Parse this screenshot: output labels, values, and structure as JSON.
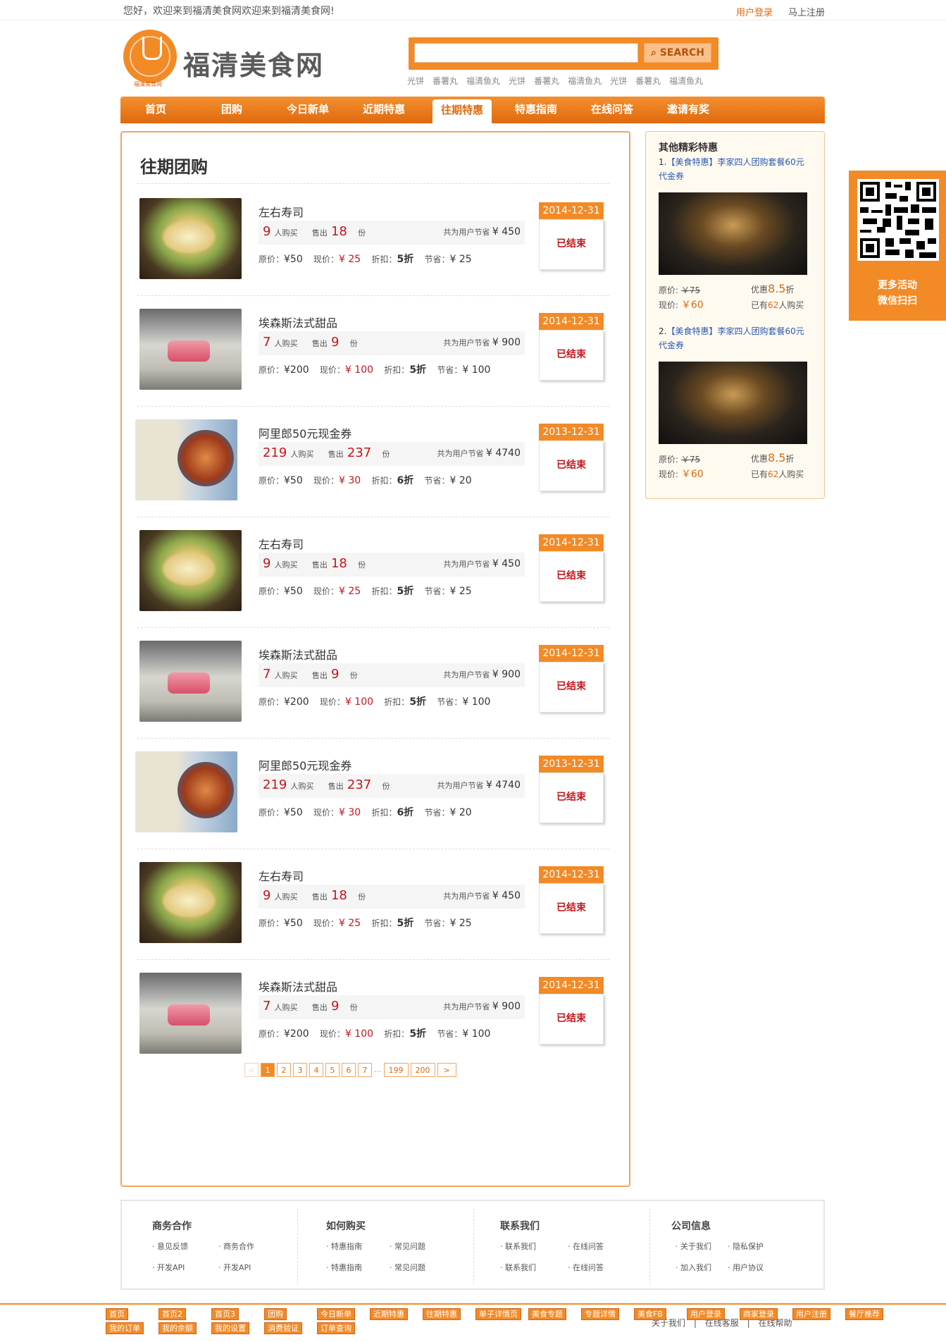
{
  "topbar": {
    "welcome": "您好，欢迎来到福清美食网欢迎来到福清美食网!",
    "login": "用户登录",
    "register": "马上注册"
  },
  "header": {
    "logo_text": "福清美食网",
    "logo_sub": "福清美食网",
    "search_placeholder": "",
    "search_button": "SEARCH",
    "hot_words": [
      "光饼",
      "番薯丸",
      "福清鱼丸",
      "光饼",
      "番薯丸",
      "福清鱼丸",
      "光饼",
      "番薯丸",
      "福清鱼丸"
    ]
  },
  "nav": {
    "items": [
      "首页",
      "团购",
      "今日新单",
      "近期特惠",
      "往期特惠",
      "特惠指南",
      "在线问答",
      "邀请有奖"
    ],
    "active_index": 4
  },
  "main": {
    "title": "往期团购",
    "deals": [
      {
        "name": "左右寿司",
        "buyers": "9",
        "buy_label": "人购买",
        "sold_label": "售出",
        "sold": "18",
        "unit": "份",
        "save_label": "共为用户节省",
        "save": "¥ 450",
        "orig_label": "原价：",
        "orig": "¥50",
        "now_label": "现价：",
        "now": "¥ 25",
        "disc_label": "折扣：",
        "disc": "5折",
        "saved_label": "节省：",
        "saved": "¥ 25",
        "date": "2014-12-31",
        "status": "已结束",
        "photo": "sushi"
      },
      {
        "name": "埃森斯法式甜品",
        "buyers": "7",
        "buy_label": "人购买",
        "sold_label": "售出",
        "sold": "9",
        "unit": "份",
        "save_label": "共为用户节省",
        "save": "¥ 900",
        "orig_label": "原价：",
        "orig": "¥200",
        "now_label": "现价：",
        "now": "¥ 100",
        "disc_label": "折扣：",
        "disc": "5折",
        "saved_label": "节省：",
        "saved": "¥ 100",
        "date": "2014-12-31",
        "status": "已结束",
        "photo": "cake"
      },
      {
        "name": "阿里郎50元现金券",
        "buyers": "219",
        "buy_label": "人购买",
        "sold_label": "售出",
        "sold": "237",
        "unit": "份",
        "save_label": "共为用户节省",
        "save": "¥ 4740",
        "orig_label": "原价：",
        "orig": "¥50",
        "now_label": "现价：",
        "now": "¥ 30",
        "disc_label": "折扣：",
        "disc": "6折",
        "saved_label": "节省：",
        "saved": "¥ 20",
        "date": "2013-12-31",
        "status": "已结束",
        "photo": "coupon"
      },
      {
        "name": "左右寿司",
        "buyers": "9",
        "buy_label": "人购买",
        "sold_label": "售出",
        "sold": "18",
        "unit": "份",
        "save_label": "共为用户节省",
        "save": "¥ 450",
        "orig_label": "原价：",
        "orig": "¥50",
        "now_label": "现价：",
        "now": "¥ 25",
        "disc_label": "折扣：",
        "disc": "5折",
        "saved_label": "节省：",
        "saved": "¥ 25",
        "date": "2014-12-31",
        "status": "已结束",
        "photo": "sushi"
      },
      {
        "name": "埃森斯法式甜品",
        "buyers": "7",
        "buy_label": "人购买",
        "sold_label": "售出",
        "sold": "9",
        "unit": "份",
        "save_label": "共为用户节省",
        "save": "¥ 900",
        "orig_label": "原价：",
        "orig": "¥200",
        "now_label": "现价：",
        "now": "¥ 100",
        "disc_label": "折扣：",
        "disc": "5折",
        "saved_label": "节省：",
        "saved": "¥ 100",
        "date": "2014-12-31",
        "status": "已结束",
        "photo": "cake"
      },
      {
        "name": "阿里郎50元现金券",
        "buyers": "219",
        "buy_label": "人购买",
        "sold_label": "售出",
        "sold": "237",
        "unit": "份",
        "save_label": "共为用户节省",
        "save": "¥ 4740",
        "orig_label": "原价：",
        "orig": "¥50",
        "now_label": "现价：",
        "now": "¥ 30",
        "disc_label": "折扣：",
        "disc": "6折",
        "saved_label": "节省：",
        "saved": "¥ 20",
        "date": "2013-12-31",
        "status": "已结束",
        "photo": "coupon"
      },
      {
        "name": "左右寿司",
        "buyers": "9",
        "buy_label": "人购买",
        "sold_label": "售出",
        "sold": "18",
        "unit": "份",
        "save_label": "共为用户节省",
        "save": "¥ 450",
        "orig_label": "原价：",
        "orig": "¥50",
        "now_label": "现价：",
        "now": "¥ 25",
        "disc_label": "折扣：",
        "disc": "5折",
        "saved_label": "节省：",
        "saved": "¥ 25",
        "date": "2014-12-31",
        "status": "已结束",
        "photo": "sushi"
      },
      {
        "name": "埃森斯法式甜品",
        "buyers": "7",
        "buy_label": "人购买",
        "sold_label": "售出",
        "sold": "9",
        "unit": "份",
        "save_label": "共为用户节省",
        "save": "¥ 900",
        "orig_label": "原价：",
        "orig": "¥200",
        "now_label": "现价：",
        "now": "¥ 100",
        "disc_label": "折扣：",
        "disc": "5折",
        "saved_label": "节省：",
        "saved": "¥ 100",
        "date": "2014-12-31",
        "status": "已结束",
        "photo": "cake"
      }
    ],
    "pager": {
      "prev": "<",
      "pages": [
        "1",
        "2",
        "3",
        "4",
        "5",
        "6",
        "7"
      ],
      "dots": "...",
      "last_pages": [
        "199",
        "200"
      ],
      "next": ">",
      "current": "1"
    }
  },
  "sidebar": {
    "title": "其他精彩特惠",
    "items": [
      {
        "num": "1.",
        "link": "【美食特惠】李家四人团购套餐60元代金券",
        "orig_label": "原价:",
        "orig": "￥75",
        "now_label": "现价:",
        "now": "￥60",
        "disc_pre": "优惠",
        "disc": "8.5",
        "disc_post": "折",
        "bought_pre": "已有",
        "bought": "62",
        "bought_post": "人购买"
      },
      {
        "num": "2.",
        "link": "【美食特惠】李家四人团购套餐60元代金券",
        "orig_label": "原价:",
        "orig": "￥75",
        "now_label": "现价:",
        "now": "￥60",
        "disc_pre": "优惠",
        "disc": "8.5",
        "disc_post": "折",
        "bought_pre": "已有",
        "bought": "62",
        "bought_post": "人购买"
      }
    ]
  },
  "qr": {
    "line1": "更多活动",
    "line2": "微信扫扫"
  },
  "footer": {
    "cols": [
      {
        "title": "商务合作",
        "links": [
          "意见反馈",
          "商务合作",
          "开发API",
          "开发API"
        ]
      },
      {
        "title": "如何购买",
        "links": [
          "特惠指南",
          "常见问题",
          "特惠指南",
          "常见问题"
        ]
      },
      {
        "title": "联系我们",
        "links": [
          "联系我们",
          "在线问答",
          "联系我们",
          "在线问答"
        ]
      },
      {
        "title": "公司信息",
        "links": [
          "关于我们",
          "隐私保护",
          "加入我们",
          "用户协议"
        ]
      }
    ],
    "bottom_buttons_row1": [
      "首页",
      "首页2",
      "首页3",
      "团购",
      "今日新单",
      "近期特惠",
      "往期特惠",
      "单子详情页",
      "美食专题",
      "专题详情",
      "美食FB",
      "用户登录",
      "商家登录",
      "用户注册",
      "餐厅推荐"
    ],
    "bottom_buttons_row2": [
      "我的订单",
      "我的余额",
      "我的设置",
      "消费验证",
      "订单查询"
    ],
    "bottom_links": [
      "关于我们",
      "|",
      "在线客服",
      "|",
      "在线帮助"
    ]
  },
  "colors": {
    "accent": "#f28a26",
    "accent_dark": "#e06a0e",
    "red": "#c4161c",
    "link_blue": "#2a58b2"
  }
}
